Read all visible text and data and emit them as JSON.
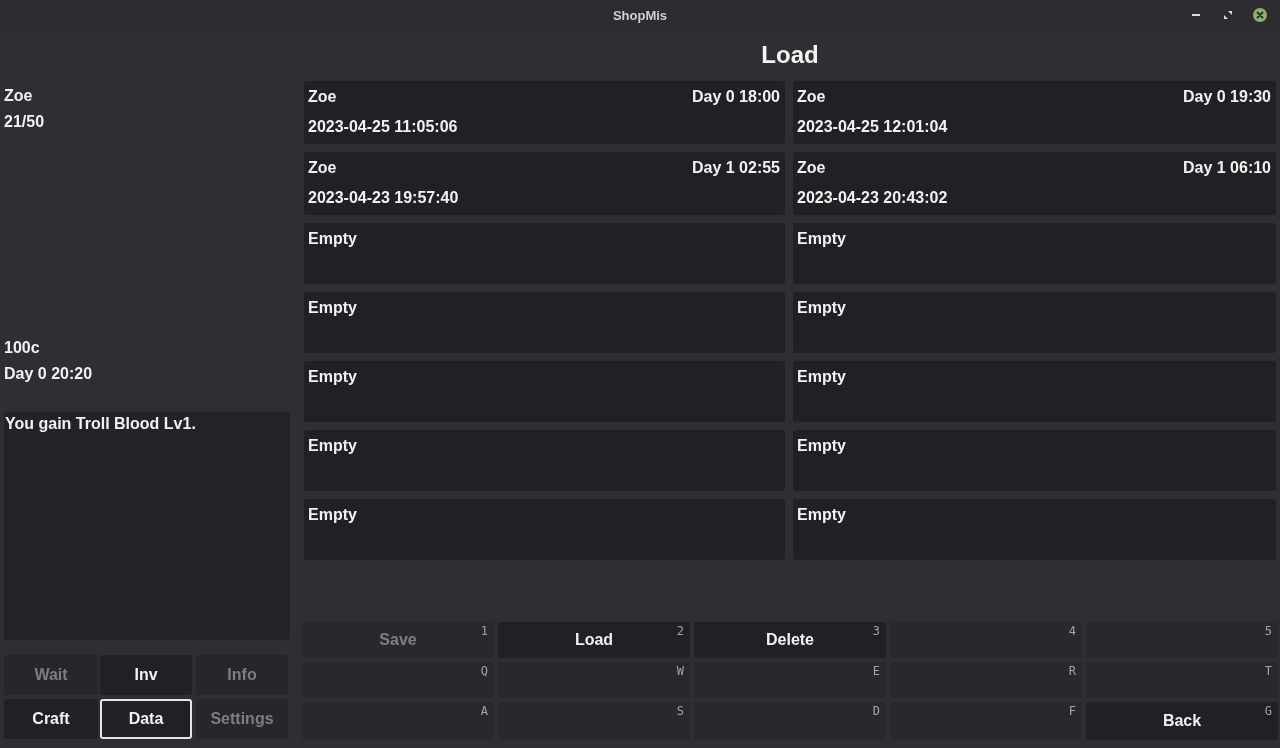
{
  "window": {
    "title": "ShopMis"
  },
  "sidebar": {
    "character": {
      "name": "Zoe",
      "health": "21/50"
    },
    "money": "100c",
    "clock": "Day 0 20:20",
    "log": [
      "You gain Troll Blood Lv1."
    ],
    "menu": [
      {
        "label": "Wait",
        "disabled": true,
        "selected": false
      },
      {
        "label": "Inv",
        "disabled": false,
        "selected": false
      },
      {
        "label": "Info",
        "disabled": true,
        "selected": false
      },
      {
        "label": "Craft",
        "disabled": false,
        "selected": false
      },
      {
        "label": "Data",
        "disabled": false,
        "selected": true
      },
      {
        "label": "Settings",
        "disabled": true,
        "selected": false
      }
    ]
  },
  "panel": {
    "title": "Load",
    "slots": [
      {
        "kind": "save",
        "name": "Zoe",
        "game_time": "Day 0 18:00",
        "saved_at": "2023-04-25 11:05:06"
      },
      {
        "kind": "save",
        "name": "Zoe",
        "game_time": "Day 0 19:30",
        "saved_at": "2023-04-25 12:01:04"
      },
      {
        "kind": "save",
        "name": "Zoe",
        "game_time": "Day 1 02:55",
        "saved_at": "2023-04-23 19:57:40"
      },
      {
        "kind": "save",
        "name": "Zoe",
        "game_time": "Day 1 06:10",
        "saved_at": "2023-04-23 20:43:02"
      },
      {
        "kind": "empty",
        "label": "Empty"
      },
      {
        "kind": "empty",
        "label": "Empty"
      },
      {
        "kind": "empty",
        "label": "Empty"
      },
      {
        "kind": "empty",
        "label": "Empty"
      },
      {
        "kind": "empty",
        "label": "Empty"
      },
      {
        "kind": "empty",
        "label": "Empty"
      },
      {
        "kind": "empty",
        "label": "Empty"
      },
      {
        "kind": "empty",
        "label": "Empty"
      },
      {
        "kind": "empty",
        "label": "Empty"
      },
      {
        "kind": "empty",
        "label": "Empty"
      }
    ]
  },
  "actions": [
    {
      "key": "1",
      "label": "Save",
      "disabled": true
    },
    {
      "key": "2",
      "label": "Load",
      "disabled": false
    },
    {
      "key": "3",
      "label": "Delete",
      "disabled": false
    },
    {
      "key": "4"
    },
    {
      "key": "5"
    },
    {
      "key": "Q"
    },
    {
      "key": "W"
    },
    {
      "key": "E"
    },
    {
      "key": "R"
    },
    {
      "key": "T"
    },
    {
      "key": "A"
    },
    {
      "key": "S"
    },
    {
      "key": "D"
    },
    {
      "key": "F"
    },
    {
      "key": "G",
      "label": "Back",
      "disabled": false
    }
  ]
}
